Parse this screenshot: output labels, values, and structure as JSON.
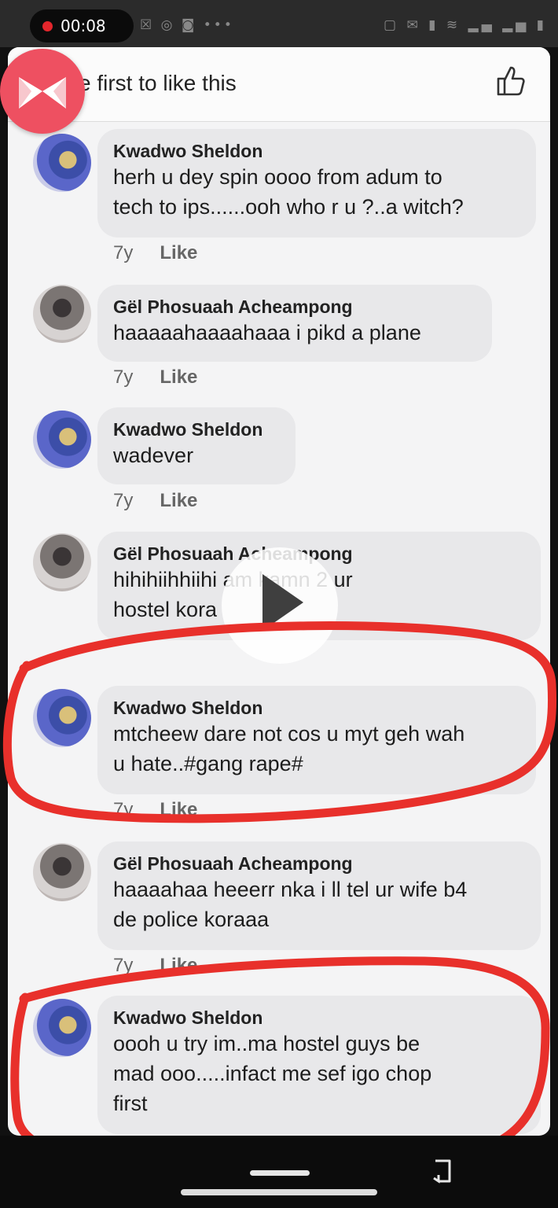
{
  "status_bar": {
    "record_time": "00:08",
    "left_icons": "☒ ◎ ◙ •••",
    "right_icons": "▢ ✉ ▮ ≋ ▂▄ ▂▅ ▮"
  },
  "header": {
    "text": "e first to like this",
    "like_icon": "thumbs-up-icon"
  },
  "comments": [
    {
      "author": "Kwadwo Sheldon",
      "lines": [
        "herh u dey spin oooo from adum to",
        "tech to ips......ooh who r u ?..a witch?"
      ],
      "age": "7y",
      "like": "Like"
    },
    {
      "author": "Gël Phosuaah Acheampong",
      "lines": [
        "haaaaahaaaahaaa i pikd a plane"
      ],
      "age": "7y",
      "like": "Like"
    },
    {
      "author": "Kwadwo Sheldon",
      "lines": [
        "wadever"
      ],
      "age": "7y",
      "like": "Like"
    },
    {
      "author": "Gël Phosuaah Acheampong",
      "lines": [
        "hihihiihhiihi am kamn 2 ur",
        "hostel kora"
      ],
      "age": "7y",
      "like": "Like"
    },
    {
      "author": "Kwadwo Sheldon",
      "lines": [
        "mtcheew dare not cos u myt geh wah",
        "u hate..#gang rape#"
      ],
      "age": "7y",
      "like": "Like"
    },
    {
      "author": "Gël Phosuaah Acheampong",
      "lines": [
        "haaaahaa heeerr nka i ll tel ur wife b4",
        "de police koraaa"
      ],
      "age": "7y",
      "like": "Like"
    },
    {
      "author": "Kwadwo Sheldon",
      "lines": [
        "oooh u try im..ma hostel guys be",
        "mad ooo.....infact me sef igo chop",
        "first"
      ]
    }
  ],
  "colors": {
    "annotation_red": "#e8302b",
    "bubble_bg": "#e8e8ea",
    "card_bg": "#f4f4f5"
  }
}
